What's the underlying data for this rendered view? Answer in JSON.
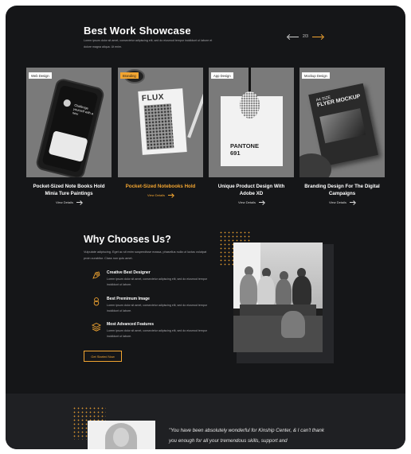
{
  "showcase": {
    "title": "Best Work Showcase",
    "description": "Lorem ipsum dolor sit amet, consectetur adipiscing elit, sed do eiusmod tempor incididunt ut labore et dolore magna aliqua. Ut enim.",
    "pager": "2/3"
  },
  "cards": [
    {
      "tag": "Web Design",
      "title": "Pocket-Sized Note Books Hold Minia Ture Paintings",
      "link": "View Details",
      "phone_text": "Challenge yourself with a new"
    },
    {
      "tag": "Branding",
      "title": "Pocket-Sized Notebooks Hold",
      "link": "View Details",
      "brand": "FLUX"
    },
    {
      "tag": "App Design",
      "title": "Unique Product Design With Adobe XD",
      "link": "View Details",
      "brand_line1": "PANTONE",
      "brand_line2": "691"
    },
    {
      "tag": "Mockup Design",
      "title": "Branding Design For The Digital Campaigns",
      "link": "View Details",
      "flyer_small": "A4 SIZE",
      "flyer_big": "FLYER MOCKUP"
    }
  ],
  "why": {
    "title": "Why Chooses Us?",
    "description": "Vulputate adipiscing. Eget ac sit enim suspendisse massa, phasellus nulla ut luctus volutpat proin curabitur. Class non quis amet.",
    "features": [
      {
        "icon": "designer-icon",
        "title": "Creative Best Designer",
        "text": "Lorem ipsum dolor sit amet, consectetur adipiscing elit, sed do eiusmod tempor incididunt ut labore."
      },
      {
        "icon": "image-icon",
        "title": "Best Premimum Image",
        "text": "Lorem ipsum dolor sit amet, consectetur adipiscing elit, sed do eiusmod tempor incididunt ut labore."
      },
      {
        "icon": "layers-icon",
        "title": "Most Advanced Features",
        "text": "Lorem ipsum dolor sit amet, consectetur adipiscing elit, sed do eiusmod tempor incididunt ut labore."
      }
    ],
    "button": "Get Started Now"
  },
  "testimonial": {
    "quote": "\"You have been absolutely wonderful for Kinship Center, & I can't thank you enough for all your tremendous skills, support and"
  },
  "colors": {
    "background": "#151618",
    "accent": "#f2a531",
    "text": "#ffffff",
    "muted": "#a9a9ad"
  }
}
